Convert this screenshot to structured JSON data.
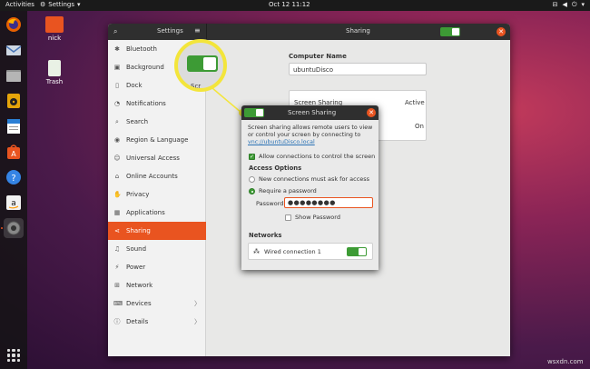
{
  "topbar": {
    "activities": "Activities",
    "app_menu": "Settings",
    "clock": "Oct 12  11:12",
    "app_menu_chevron": "▾"
  },
  "desktop": {
    "icons": [
      {
        "label": "nick"
      },
      {
        "label": "Trash"
      }
    ]
  },
  "dock": {
    "items": [
      "firefox-icon",
      "mail-icon",
      "files-icon",
      "music-icon",
      "writer-icon",
      "software-icon",
      "help-icon",
      "amazon-icon",
      "settings-icon"
    ]
  },
  "window": {
    "left_title": "Settings",
    "right_title": "Sharing"
  },
  "sidebar": {
    "items": [
      {
        "label": "Bluetooth",
        "icon": "✱"
      },
      {
        "label": "Background",
        "icon": "▣"
      },
      {
        "label": "Dock",
        "icon": "▯"
      },
      {
        "label": "Notifications",
        "icon": "◔"
      },
      {
        "label": "Search",
        "icon": "⌕"
      },
      {
        "label": "Region & Language",
        "icon": "◉"
      },
      {
        "label": "Universal Access",
        "icon": "☺"
      },
      {
        "label": "Online Accounts",
        "icon": "⌂"
      },
      {
        "label": "Privacy",
        "icon": "✋"
      },
      {
        "label": "Applications",
        "icon": "▦"
      },
      {
        "label": "Sharing",
        "icon": "⋖"
      },
      {
        "label": "Sound",
        "icon": "♫"
      },
      {
        "label": "Power",
        "icon": "⚡"
      },
      {
        "label": "Network",
        "icon": "⊞"
      },
      {
        "label": "Devices",
        "icon": "⌨"
      },
      {
        "label": "Details",
        "icon": "ⓘ"
      }
    ],
    "chevron": "〉"
  },
  "main": {
    "computer_name_label": "Computer Name",
    "computer_name_value": "ubuntuDisco",
    "rows": [
      {
        "label": "Screen Sharing",
        "value": "Active"
      },
      {
        "label": "",
        "value": "On"
      }
    ]
  },
  "callout": {
    "cut_label": "Scr"
  },
  "dialog": {
    "title": "Screen Sharing",
    "description": "Screen sharing allows remote users to view or control your screen by connecting to",
    "link": "vnc://ubuntuDisco.local",
    "allow_control": "Allow connections to control the screen",
    "access_header": "Access Options",
    "option_ask": "New connections must ask for access",
    "option_password": "Require a password",
    "password_label": "Password:",
    "password_value": "●●●●●●●●",
    "show_password": "Show Password",
    "networks_header": "Networks",
    "network_name": "Wired connection 1"
  },
  "watermark": "wsxdn.com"
}
